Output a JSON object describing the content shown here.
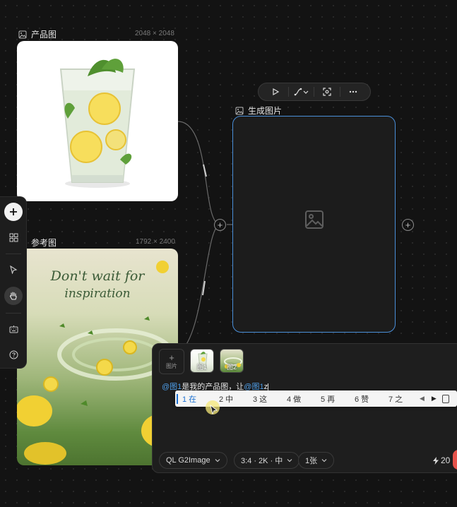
{
  "product_node": {
    "title": "产品图",
    "dims": "2048 × 2048"
  },
  "reference_node": {
    "title": "参考图",
    "dims": "1792 × 2400",
    "image_text_line1": "Don't wait for",
    "image_text_line2": "inspiration"
  },
  "generate_node": {
    "title": "生成图片"
  },
  "prompt": {
    "add_label": "图片",
    "thumbs": [
      "图1",
      "图2"
    ],
    "text_parts": [
      "@图1",
      "是我的产品图，让",
      "@图1",
      "z"
    ]
  },
  "ime": {
    "candidates": [
      "1 在",
      "2 中",
      "3 这",
      "4 做",
      "5 再",
      "6 赞",
      "7 之"
    ]
  },
  "controls": {
    "model": "QL G2Image",
    "settings": "3:4 · 2K · 中",
    "count": "1张",
    "credits": "20"
  },
  "colors": {
    "accent": "#4a8fd9",
    "mention": "#4d9ce6"
  }
}
